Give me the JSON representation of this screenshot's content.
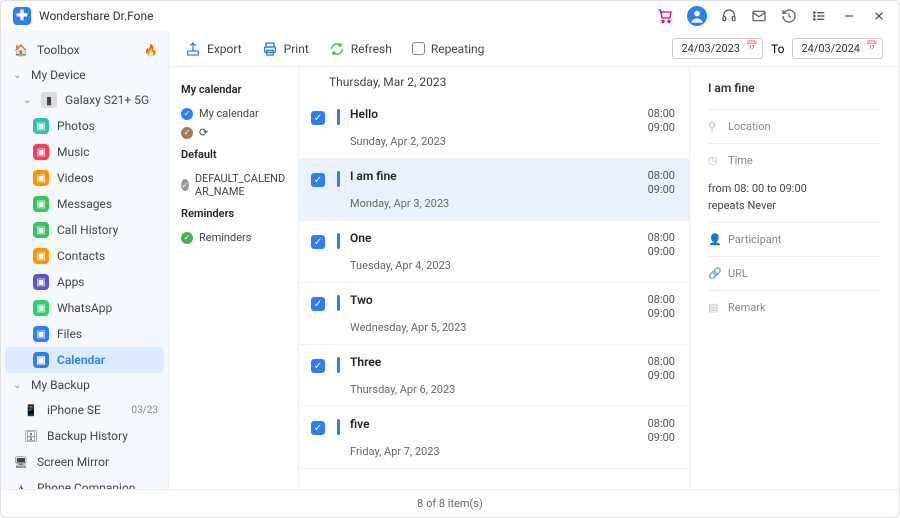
{
  "app": {
    "title": "Wondershare Dr.Fone"
  },
  "sidebar": {
    "toolbox": "Toolbox",
    "mydevice": "My Device",
    "device_name": "Galaxy S21+ 5G",
    "items": [
      {
        "label": "Photos",
        "color": "#2dc2b4"
      },
      {
        "label": "Music",
        "color": "#ff3b5c"
      },
      {
        "label": "Videos",
        "color": "#ff9500"
      },
      {
        "label": "Messages",
        "color": "#34c759"
      },
      {
        "label": "Call History",
        "color": "#34c759"
      },
      {
        "label": "Contacts",
        "color": "#ff9500"
      },
      {
        "label": "Apps",
        "color": "#5856d6"
      },
      {
        "label": "WhatsApp",
        "color": "#25d366"
      },
      {
        "label": "Files",
        "color": "#2d7ff9"
      },
      {
        "label": "Calendar",
        "color": "#2d7ff9"
      }
    ],
    "mybackup": "My Backup",
    "backup_device": "iPhone SE",
    "backup_badge": "03/23",
    "backup_history": "Backup History",
    "screen_mirror": "Screen Mirror",
    "phone_companion": "Phone Companion"
  },
  "toolbar": {
    "export": "Export",
    "print": "Print",
    "refresh": "Refresh",
    "repeating": "Repeating",
    "date_from": "24/03/2023",
    "date_to_label": "To",
    "date_to": "24/03/2024"
  },
  "calendars": {
    "section_my": "My calendar",
    "my_cal": "My calendar",
    "loading": "⟳",
    "section_default": "Default",
    "default_name": "DEFAULT_CALENDAR_NAME",
    "section_reminders": "Reminders",
    "reminders": "Reminders"
  },
  "events": {
    "top_date": "Thursday, Mar 2, 2023",
    "list": [
      {
        "title": "Hello",
        "date": "Sunday, Apr 2, 2023",
        "t1": "08:00",
        "t2": "09:00"
      },
      {
        "title": "I am fine",
        "date": "Monday, Apr 3, 2023",
        "t1": "08:00",
        "t2": "09:00"
      },
      {
        "title": "One",
        "date": "Tuesday, Apr 4, 2023",
        "t1": "08:00",
        "t2": "09:00"
      },
      {
        "title": "Two",
        "date": "Wednesday, Apr 5, 2023",
        "t1": "08:00",
        "t2": "09:00"
      },
      {
        "title": "Three",
        "date": "Thursday, Apr 6, 2023",
        "t1": "08:00",
        "t2": "09:00"
      },
      {
        "title": "five",
        "date": "Friday, Apr 7, 2023",
        "t1": "08:00",
        "t2": "09:00"
      }
    ]
  },
  "details": {
    "title": "I am fine",
    "location_label": "Location",
    "time_label": "Time",
    "time_value1": "from 08: 00 to 09:00",
    "time_value2": "repeats Never",
    "participant_label": "Participant",
    "url_label": "URL",
    "remark_label": "Remark"
  },
  "status": {
    "text": "8  of  8 item(s)"
  }
}
